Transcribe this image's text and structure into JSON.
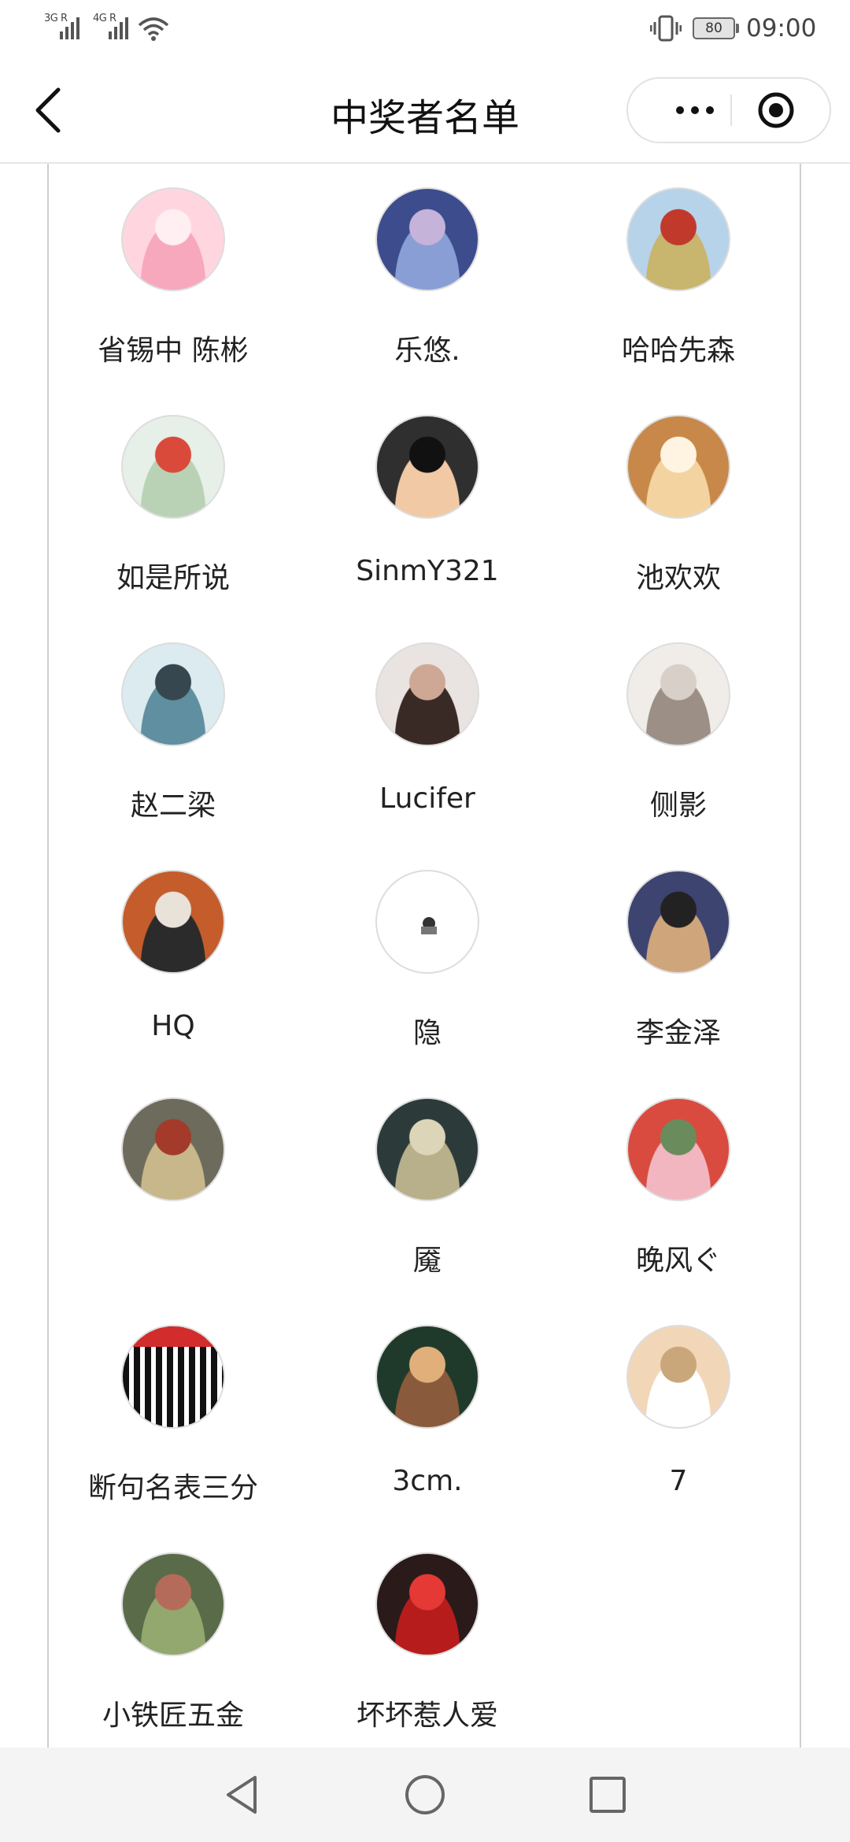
{
  "status": {
    "sim1_label": "3G R",
    "sim2_label": "4G R",
    "battery": "80",
    "time": "09:00"
  },
  "nav": {
    "title": "中奖者名单"
  },
  "winners": [
    {
      "name": "省锡中 陈彬",
      "avatar": "pink-pig-avatar"
    },
    {
      "name": "乐悠.",
      "avatar": "boy-on-rock-avatar"
    },
    {
      "name": "哈哈先森",
      "avatar": "girl-with-balloons-avatar"
    },
    {
      "name": "如是所说",
      "avatar": "baby-avatar"
    },
    {
      "name": "SinmY321",
      "avatar": "cartoon-man-with-glasses-avatar"
    },
    {
      "name": "池欢欢",
      "avatar": "smiling-dog-avatar"
    },
    {
      "name": "赵二梁",
      "avatar": "hanging-chain-art-avatar"
    },
    {
      "name": "Lucifer",
      "avatar": "woman-with-cat-ears-avatar"
    },
    {
      "name": "侧影",
      "avatar": "cat-avatar"
    },
    {
      "name": "HQ",
      "avatar": "anime-character-avatar"
    },
    {
      "name": "隐",
      "avatar": "small-figure-avatar"
    },
    {
      "name": "李金泽",
      "avatar": "laughing-child-avatar"
    },
    {
      "name": "",
      "avatar": "red-dress-couple-avatar"
    },
    {
      "name": "魇",
      "avatar": "chalk-text-avatar"
    },
    {
      "name": "晚风ぐ",
      "avatar": "girl-on-fence-avatar"
    },
    {
      "name": "断句名表三分",
      "avatar": "qr-code-poster-avatar"
    },
    {
      "name": "3cm.",
      "avatar": "crowned-kid-avatar"
    },
    {
      "name": "7",
      "avatar": "astronaut-with-flowers-avatar"
    },
    {
      "name": "小铁匠五金",
      "avatar": "garden-house-avatar"
    },
    {
      "name": "坏坏惹人爱",
      "avatar": "superman-logo-avatar"
    }
  ]
}
